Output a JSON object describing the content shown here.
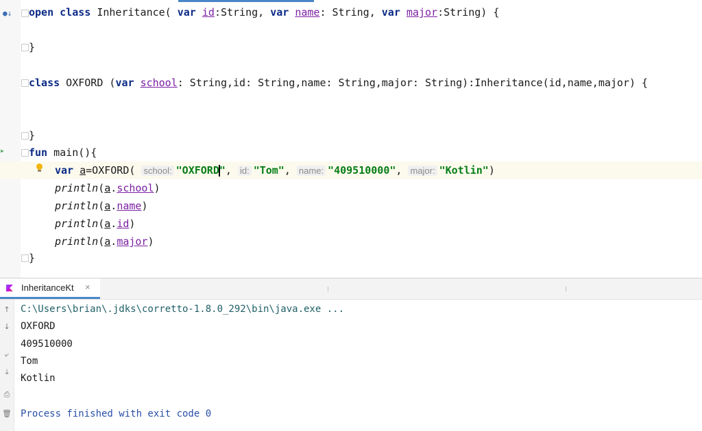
{
  "editor": {
    "lines": {
      "l1": {
        "open": "open",
        "class": "class",
        "name": " Inheritance( ",
        "var1": "var",
        "sp1": " ",
        "id": "id",
        "t1": ":String, ",
        "var2": "var",
        "sp2": " ",
        "pname": "name",
        "t2": ": String, ",
        "var3": "var",
        "sp3": " ",
        "major": "major",
        "t3": ":String) {"
      },
      "l2": {
        "text": "}"
      },
      "l3": {
        "class": "class",
        "rest1": " OXFORD (",
        "var": "var",
        "sp": " ",
        "school": "school",
        "rest2": ": String,id: String,name: String,major: String):Inheritance(id,name,major) {"
      },
      "l4": {
        "text": "}"
      },
      "l5": {
        "fun": "fun",
        "rest": " main(){"
      },
      "l6": {
        "var": "var",
        "a": "a",
        "call": "=OXFORD(",
        "hint_school": "school:",
        "v_school_a": "\"OXFORD",
        "v_school_b": "\"",
        "c1": ", ",
        "hint_id": "id:",
        "v_id": "\"Tom\"",
        "c2": ", ",
        "hint_name": "name:",
        "v_name": "\"409510000\"",
        "c3": ", ",
        "hint_major": "major:",
        "v_major": "\"Kotlin\"",
        "close": ")"
      },
      "l7": {
        "fn": "println",
        "open": "(",
        "a": "a",
        "dot": ".",
        "prop": "school",
        "close": ")"
      },
      "l8": {
        "fn": "println",
        "open": "(",
        "a": "a",
        "dot": ".",
        "prop": "name",
        "close": ")"
      },
      "l9": {
        "fn": "println",
        "open": "(",
        "a": "a",
        "dot": ".",
        "prop": "id",
        "close": ")"
      },
      "l10": {
        "fn": "println",
        "open": "(",
        "a": "a",
        "dot": ".",
        "prop": "major",
        "close": ")"
      },
      "l11": {
        "text": "}"
      }
    },
    "gutter_icon": "run-config-icon",
    "run_arrow_icon": "run-arrow-icon",
    "bulb_icon": "lightbulb-icon"
  },
  "run_panel": {
    "tab_label": "InheritanceKt",
    "tab_close": "×",
    "output": [
      "C:\\Users\\brian\\.jdks\\corretto-1.8.0_292\\bin\\java.exe ...",
      "OXFORD",
      "409510000",
      "Tom",
      "Kotlin",
      "",
      "Process finished with exit code 0"
    ],
    "toolbar_icons": [
      "up-arrow-icon",
      "down-arrow-icon",
      "soft-wrap-icon",
      "scroll-to-end-icon",
      "print-icon",
      "trash-icon"
    ],
    "toolbar_glyphs": [
      "↑",
      "↓",
      "⤶",
      "⤓",
      "⎙",
      "🗑"
    ]
  },
  "colors": {
    "keyword": "#0b2a86",
    "string": "#067d17",
    "property": "#7a1fa2",
    "accent": "#4a86c7",
    "highlight": "#fcfaed"
  }
}
